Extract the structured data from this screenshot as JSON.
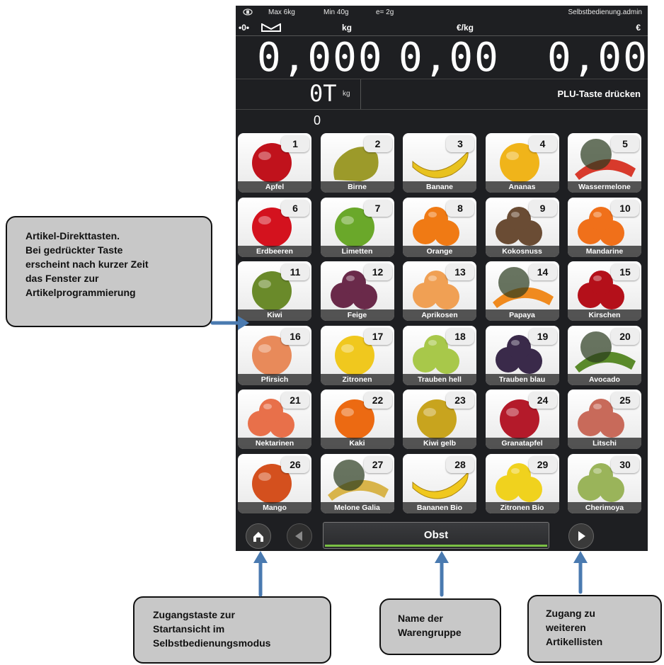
{
  "status": {
    "icon": "scale-status-icon",
    "max": "Max 6kg",
    "min": "Min 40g",
    "e": "e= 2g",
    "user": "Selbstbedienung.admin"
  },
  "header": {
    "zero_symbol": "•0•",
    "kg": "kg",
    "price_unit": "€/kg",
    "currency": "€"
  },
  "display": {
    "weight": "0,000",
    "unit_price": "0,00",
    "total": "0,00",
    "tare": "0T",
    "tare_unit": "kg",
    "message": "PLU-Taste drücken",
    "counter": "0"
  },
  "tiles": [
    {
      "n": "1",
      "label": "Apfel",
      "color": "#c0121c",
      "shape": "round"
    },
    {
      "n": "2",
      "label": "Birne",
      "color": "#9c9a2a",
      "shape": "pear"
    },
    {
      "n": "3",
      "label": "Banane",
      "color": "#e8c21e",
      "shape": "banana"
    },
    {
      "n": "4",
      "label": "Ananas",
      "color": "#f0b41a",
      "shape": "round"
    },
    {
      "n": "5",
      "label": "Wassermelone",
      "color": "#d83a2c",
      "shape": "slice"
    },
    {
      "n": "6",
      "label": "Erdbeeren",
      "color": "#d4121e",
      "shape": "round"
    },
    {
      "n": "7",
      "label": "Limetten",
      "color": "#6aa82a",
      "shape": "round"
    },
    {
      "n": "8",
      "label": "Orange",
      "color": "#f07a14",
      "shape": "cluster"
    },
    {
      "n": "9",
      "label": "Kokosnuss",
      "color": "#6a4c34",
      "shape": "cluster"
    },
    {
      "n": "10",
      "label": "Mandarine",
      "color": "#f0701a",
      "shape": "cluster"
    },
    {
      "n": "11",
      "label": "Kiwi",
      "color": "#6a8a2a",
      "shape": "round"
    },
    {
      "n": "12",
      "label": "Feige",
      "color": "#6a2a4a",
      "shape": "cluster"
    },
    {
      "n": "13",
      "label": "Aprikosen",
      "color": "#f0a054",
      "shape": "cluster"
    },
    {
      "n": "14",
      "label": "Papaya",
      "color": "#f08a1e",
      "shape": "slice"
    },
    {
      "n": "15",
      "label": "Kirschen",
      "color": "#b4101a",
      "shape": "cluster"
    },
    {
      "n": "16",
      "label": "Pfirsich",
      "color": "#e88a5a",
      "shape": "round"
    },
    {
      "n": "17",
      "label": "Zitronen",
      "color": "#f0c81e",
      "shape": "round"
    },
    {
      "n": "18",
      "label": "Trauben hell",
      "color": "#a8c84a",
      "shape": "cluster"
    },
    {
      "n": "19",
      "label": "Trauben blau",
      "color": "#3a2a4a",
      "shape": "cluster"
    },
    {
      "n": "20",
      "label": "Avocado",
      "color": "#5a8a2a",
      "shape": "slice"
    },
    {
      "n": "21",
      "label": "Nektarinen",
      "color": "#e8704a",
      "shape": "cluster"
    },
    {
      "n": "22",
      "label": "Kaki",
      "color": "#ec6a12",
      "shape": "round"
    },
    {
      "n": "23",
      "label": "Kiwi gelb",
      "color": "#c8a41e",
      "shape": "round"
    },
    {
      "n": "24",
      "label": "Granatapfel",
      "color": "#b41a2a",
      "shape": "round"
    },
    {
      "n": "25",
      "label": "Litschi",
      "color": "#c86a5a",
      "shape": "cluster"
    },
    {
      "n": "26",
      "label": "Mango",
      "color": "#d4501e",
      "shape": "round"
    },
    {
      "n": "27",
      "label": "Melone Galia",
      "color": "#d8b44a",
      "shape": "slice"
    },
    {
      "n": "28",
      "label": "Bananen Bio",
      "color": "#f0c81e",
      "shape": "banana"
    },
    {
      "n": "29",
      "label": "Zitronen Bio",
      "color": "#f0d21e",
      "shape": "cluster"
    },
    {
      "n": "30",
      "label": "Cherimoya",
      "color": "#9ab45a",
      "shape": "cluster"
    }
  ],
  "bottom": {
    "home_icon": "home-icon",
    "prev_icon": "arrow-left-icon",
    "next_icon": "arrow-right-icon",
    "group": "Obst",
    "accent": "#7ac143"
  },
  "callouts": {
    "tiles": "Artikel-Direkttasten.\nBei gedrückter Taste\nerscheint nach kurzer Zeit\ndas Fenster zur\nArtikelprogrammierung",
    "home": "Zugangstaste zur\nStartansicht im\nSelbstbedienungsmodus",
    "group": "Name der\nWarengruppe",
    "next": "Zugang zu\nweiteren\nArtikellisten",
    "arrow_color": "#4a7ab0"
  }
}
